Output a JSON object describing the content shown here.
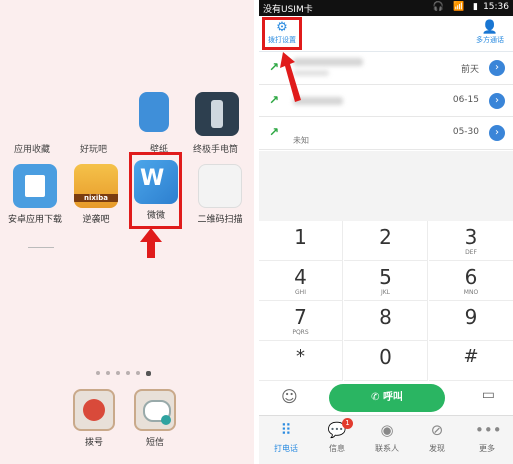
{
  "home": {
    "partial_labels": [
      "应用收藏",
      "好玩吧",
      "壁纸",
      "终极手电筒"
    ],
    "apps": [
      {
        "label": "安卓应用下载",
        "icon": "shopping-bag-icon"
      },
      {
        "label": "逆袭吧",
        "icon": "treasure-chest-icon",
        "tag": "nixiba"
      },
      {
        "label": "微微",
        "icon": "weiwei-app-icon",
        "glyph": "W"
      },
      {
        "label": "二维码扫描",
        "icon": "qr-scan-icon"
      }
    ],
    "dock": [
      {
        "label": "拨号",
        "icon": "dialer-icon"
      },
      {
        "label": "短信",
        "icon": "sms-icon"
      }
    ],
    "page_count": 6,
    "active_page": 6
  },
  "dialer": {
    "status": {
      "carrier": "没有USIM卡",
      "icons": "🎧 📶 ▮",
      "time": "15:36"
    },
    "header": {
      "left_label": "拨打设置",
      "right_label": "多方通话"
    },
    "calls": [
      {
        "date": "前天",
        "subtitle": ""
      },
      {
        "date": "06-15",
        "subtitle": ""
      },
      {
        "date": "05-30",
        "subtitle": "未知"
      }
    ],
    "keys": [
      {
        "num": "1",
        "sub": ""
      },
      {
        "num": "2",
        "sub": ""
      },
      {
        "num": "3",
        "sub": "DEF"
      },
      {
        "num": "4",
        "sub": "GHI"
      },
      {
        "num": "5",
        "sub": "JKL"
      },
      {
        "num": "6",
        "sub": "MNO"
      },
      {
        "num": "7",
        "sub": "PQRS"
      },
      {
        "num": "8",
        "sub": ""
      },
      {
        "num": "9",
        "sub": ""
      },
      {
        "num": "*",
        "sub": ""
      },
      {
        "num": "0",
        "sub": ""
      },
      {
        "num": "#",
        "sub": ""
      }
    ],
    "call_button": "呼叫",
    "tabs": [
      {
        "label": "打电话",
        "icon": "keypad-icon",
        "active": true
      },
      {
        "label": "信息",
        "icon": "message-icon",
        "badge": "1"
      },
      {
        "label": "联系人",
        "icon": "contacts-icon"
      },
      {
        "label": "发现",
        "icon": "compass-icon"
      },
      {
        "label": "更多",
        "icon": "more-icon"
      }
    ]
  },
  "colors": {
    "accent": "#2a8be0",
    "call_green": "#2ab562",
    "highlight_red": "#e01b1b"
  }
}
